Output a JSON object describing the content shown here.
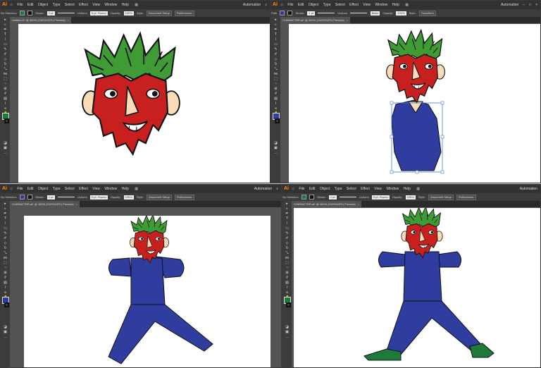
{
  "panes": [
    {
      "menu": [
        "File",
        "Edit",
        "Object",
        "Type",
        "Select",
        "Effect",
        "View",
        "Window",
        "Help"
      ],
      "right_status": "Automation",
      "ctrl": {
        "selection": "No Selection",
        "stroke_label": "Stroke:",
        "stroke_value": "1 pt",
        "profile": "Uniform",
        "brush": "5 pt. Round",
        "opacity_label": "Opacity:",
        "opacity_value": "100%",
        "style_label": "Style:",
        "btn1": "Document Setup",
        "btn2": "Preferences"
      },
      "doc_tab": "Untitled-2* @ 300% (CMYK/GPU Preview)",
      "fill_color": "#1e7a3a"
    },
    {
      "menu": [
        "File",
        "Edit",
        "Object",
        "Type",
        "Select",
        "Effect",
        "View",
        "Window",
        "Help"
      ],
      "right_status": "Automation",
      "ctrl": {
        "selection": "Path",
        "stroke_label": "Stroke:",
        "stroke_value": "1 pt",
        "profile": "Uniform",
        "brush": "Basic",
        "opacity_label": "Opacity:",
        "opacity_value": "100%",
        "style_label": "Style:",
        "btn1": "Transform",
        "btn2": ""
      },
      "doc_tab": "CHARACTER.ai* @ 200% (CMYK/GPU Preview)",
      "fill_color": "#2e3d9e"
    },
    {
      "menu": [
        "File",
        "Edit",
        "Object",
        "Type",
        "Select",
        "Effect",
        "View",
        "Window",
        "Help"
      ],
      "right_status": "Automation",
      "ctrl": {
        "selection": "No Selection",
        "stroke_label": "Stroke:",
        "stroke_value": "1 pt",
        "profile": "Uniform",
        "brush": "5 pt. Round",
        "opacity_label": "Opacity:",
        "opacity_value": "100%",
        "style_label": "Style:",
        "btn1": "Document Setup",
        "btn2": "Preferences"
      },
      "doc_tab": "CHARACTER.ai* @ 150% (CMYK/GPU Preview)",
      "fill_color": "#2e3d9e"
    },
    {
      "menu": [
        "File",
        "Edit",
        "Object",
        "Type",
        "Select",
        "Effect",
        "View",
        "Window",
        "Help"
      ],
      "right_status": "Automation",
      "ctrl": {
        "selection": "No Selection",
        "stroke_label": "Stroke:",
        "stroke_value": "1 pt",
        "profile": "Uniform",
        "brush": "5 pt. Round",
        "opacity_label": "Opacity:",
        "opacity_value": "100%",
        "style_label": "Style:",
        "btn1": "Document Setup",
        "btn2": "Preferences"
      },
      "doc_tab": "CHARACTER.ai* @ 150% (CMYK/GPU Preview)",
      "fill_color": "#1e7a3a"
    }
  ],
  "app_label": "Ai",
  "colors": {
    "crown": "#3f9c35",
    "beard": "#c8201e",
    "skin": "#f7dcb7",
    "body": "#2e3d9e",
    "shoe": "#1e7a3a",
    "stroke": "#111111"
  }
}
